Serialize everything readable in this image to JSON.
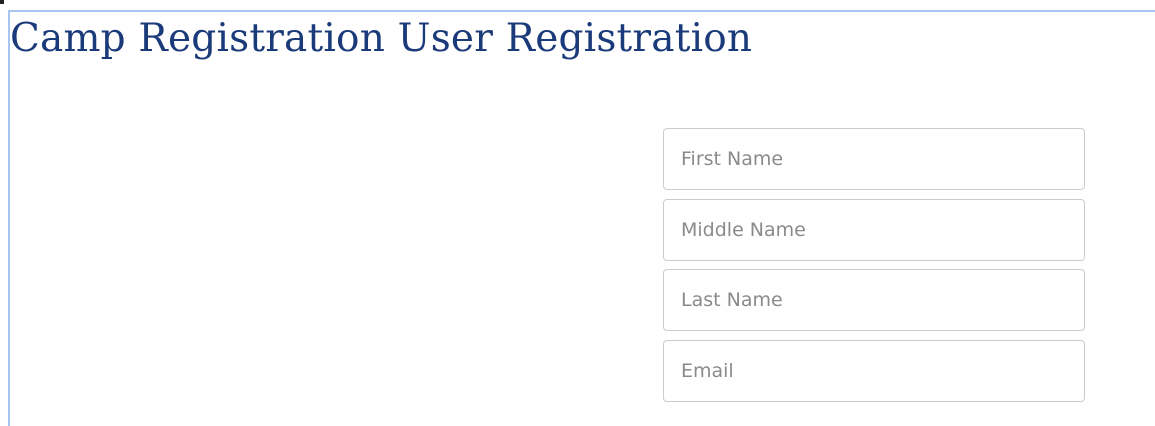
{
  "page": {
    "title": "Camp Registration User Registration"
  },
  "form": {
    "first_name": {
      "placeholder": "First Name",
      "value": ""
    },
    "middle_name": {
      "placeholder": "Middle Name",
      "value": ""
    },
    "last_name": {
      "placeholder": "Last Name",
      "value": ""
    },
    "email": {
      "placeholder": "Email",
      "value": ""
    }
  },
  "colors": {
    "title": "#1a3a7a",
    "frame_border": "#a8c4f0",
    "input_border": "#cccccc",
    "placeholder": "#8a8a8a"
  }
}
